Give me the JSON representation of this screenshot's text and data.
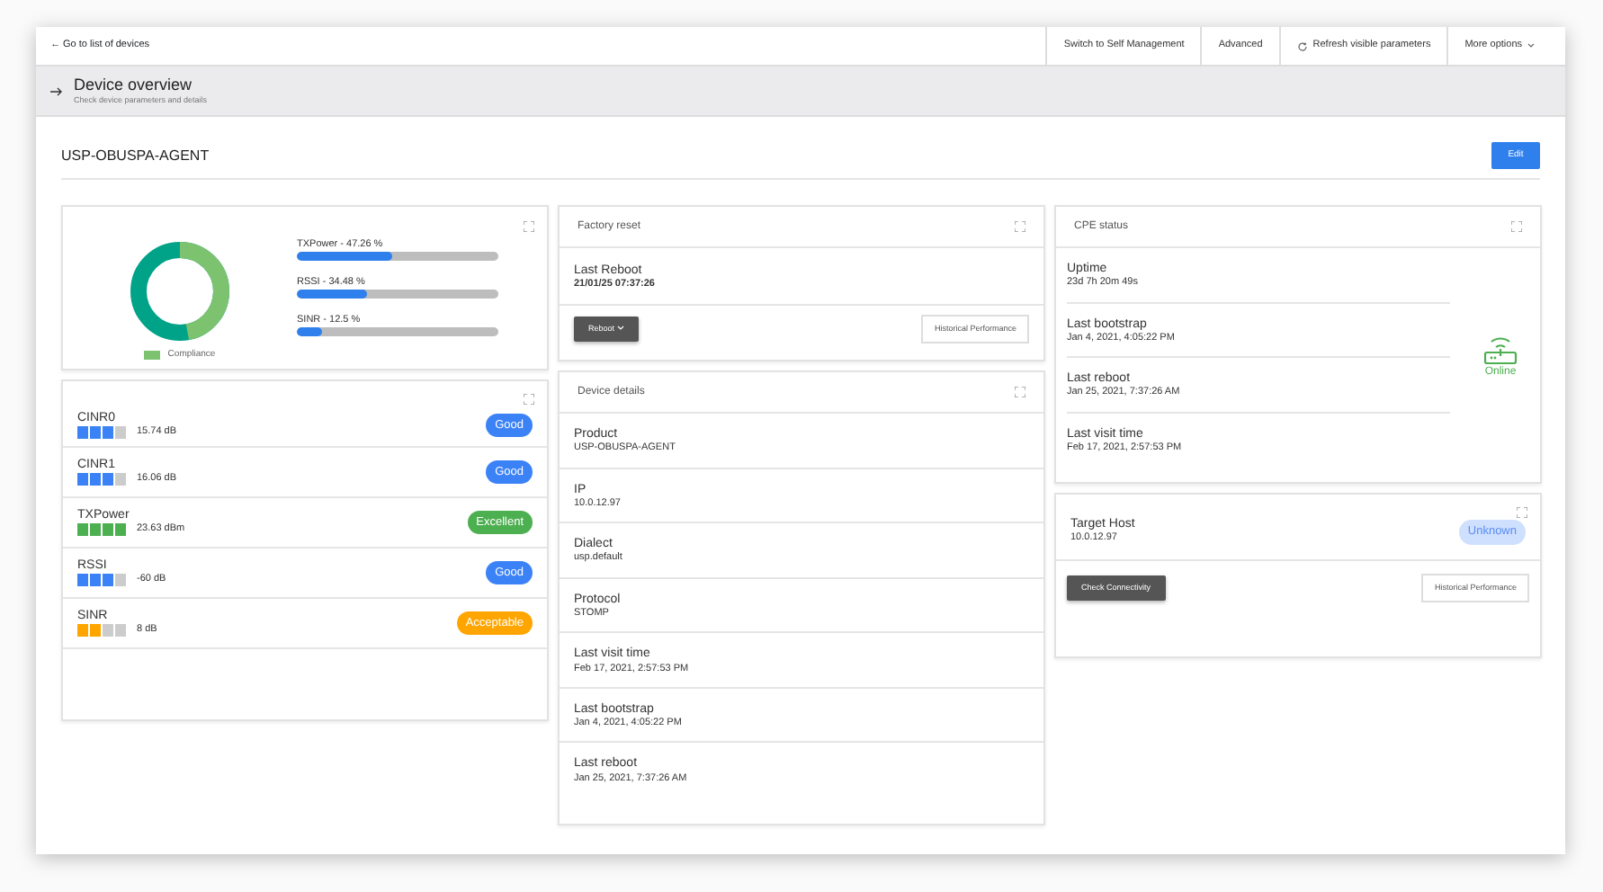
{
  "topbar": {
    "back_link": "← Go to list of devices",
    "actions": [
      {
        "label": "Switch to Self Management",
        "kind": "plain"
      },
      {
        "label": "Advanced",
        "kind": "plain"
      },
      {
        "label": "Refresh visible parameters",
        "kind": "refresh"
      },
      {
        "label": "More options",
        "kind": "dropdown"
      }
    ]
  },
  "header": {
    "title": "Device overview",
    "subtitle": "Check device parameters and details"
  },
  "device": {
    "name": "USP-OBUSPA-AGENT",
    "edit_button": "Edit"
  },
  "compliance": {
    "legend": "Compliance",
    "bars": [
      {
        "label": "TXPower - 47.26 %",
        "level": 0.4726
      },
      {
        "label": "RSSI - 34.48 %",
        "level": 0.3448
      },
      {
        "label": "SINR - 12.5 %",
        "level": 0.125
      }
    ]
  },
  "metrics": [
    {
      "name": "CINR0",
      "value": "15.74 dB",
      "level": 0.75,
      "status": "Good",
      "color": "#3b82f6"
    },
    {
      "name": "CINR1",
      "value": "16.06 dB",
      "level": 0.75,
      "status": "Good",
      "color": "#3b82f6"
    },
    {
      "name": "TXPower",
      "value": "23.63 dBm",
      "level": 1,
      "status": "Excellent",
      "color": "#4caf50"
    },
    {
      "name": "RSSI",
      "value": "-60 dB",
      "level": 0.75,
      "status": "Good",
      "color": "#3b82f6"
    },
    {
      "name": "SINR",
      "value": "8 dB",
      "level": 0.5,
      "status": "Acceptable",
      "color": "#ffa500"
    }
  ],
  "factory_reset": {
    "title": "Factory reset",
    "label": "Last Reboot",
    "value": "21/01/25 07:37:26",
    "reboot_button": "Reboot",
    "history_button": "Historical Performance"
  },
  "device_details": {
    "title": "Device details",
    "fields": [
      {
        "label": "Product",
        "value": "USP-OBUSPA-AGENT"
      },
      {
        "label": "IP",
        "value": "10.0.12.97"
      },
      {
        "label": "Dialect",
        "value": "usp.default"
      },
      {
        "label": "Protocol",
        "value": "STOMP"
      },
      {
        "label": "Last visit time",
        "value": "Feb 17, 2021, 2:57:53 PM"
      },
      {
        "label": "Last bootstrap",
        "value": "Jan 4, 2021, 4:05:22 PM"
      },
      {
        "label": "Last reboot",
        "value": "Jan 25, 2021, 7:37:26 AM"
      }
    ]
  },
  "cpe_status": {
    "title": "CPE status",
    "status": "Online",
    "online": true,
    "fields": [
      {
        "label": "Uptime",
        "value": "23d 7h 20m 49s"
      },
      {
        "label": "Last bootstrap",
        "value": "Jan 4, 2021, 4:05:22 PM"
      },
      {
        "label": "Last reboot",
        "value": "Jan 25, 2021, 7:37:26 AM"
      },
      {
        "label": "Last visit time",
        "value": "Feb 17, 2021, 2:57:53 PM"
      }
    ]
  },
  "target_host": {
    "label": "Target Host",
    "value": "10.0.12.97",
    "status": "Unknown",
    "check_button": "Check Connectivity",
    "history_button": "Historical Performance"
  }
}
